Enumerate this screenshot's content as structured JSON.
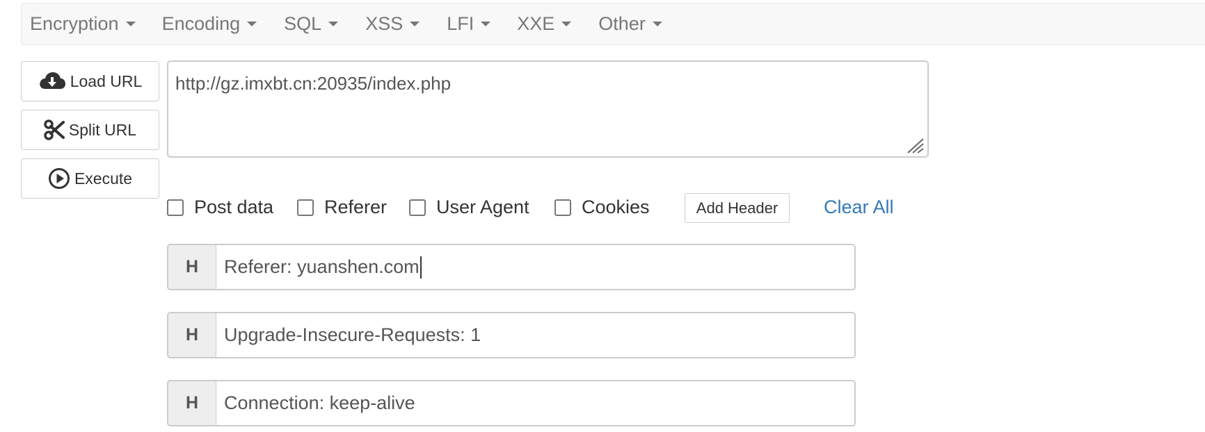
{
  "menu": {
    "items": [
      {
        "label": "Encryption"
      },
      {
        "label": "Encoding"
      },
      {
        "label": "SQL"
      },
      {
        "label": "XSS"
      },
      {
        "label": "LFI"
      },
      {
        "label": "XXE"
      },
      {
        "label": "Other"
      }
    ]
  },
  "actions": {
    "load_url": "Load URL",
    "split_url": "Split URL",
    "execute": "Execute"
  },
  "url": {
    "value": "http://gz.imxbt.cn:20935/index.php"
  },
  "options": {
    "post_data": {
      "label": "Post data",
      "checked": false
    },
    "referer": {
      "label": "Referer",
      "checked": false
    },
    "user_agent": {
      "label": "User Agent",
      "checked": false
    },
    "cookies": {
      "label": "Cookies",
      "checked": false
    },
    "add_header": "Add Header",
    "clear_all": "Clear All"
  },
  "headers": [
    {
      "addon": "H",
      "value": "Referer: yuanshen.com",
      "focused": true
    },
    {
      "addon": "H",
      "value": "Upgrade-Insecure-Requests: 1",
      "focused": false
    },
    {
      "addon": "H",
      "value": "Connection: keep-alive",
      "focused": false
    }
  ],
  "colors": {
    "link": "#337ab7",
    "menu_text": "#777777",
    "menu_bg": "#f8f8f8",
    "addon_bg": "#eeeeee"
  }
}
